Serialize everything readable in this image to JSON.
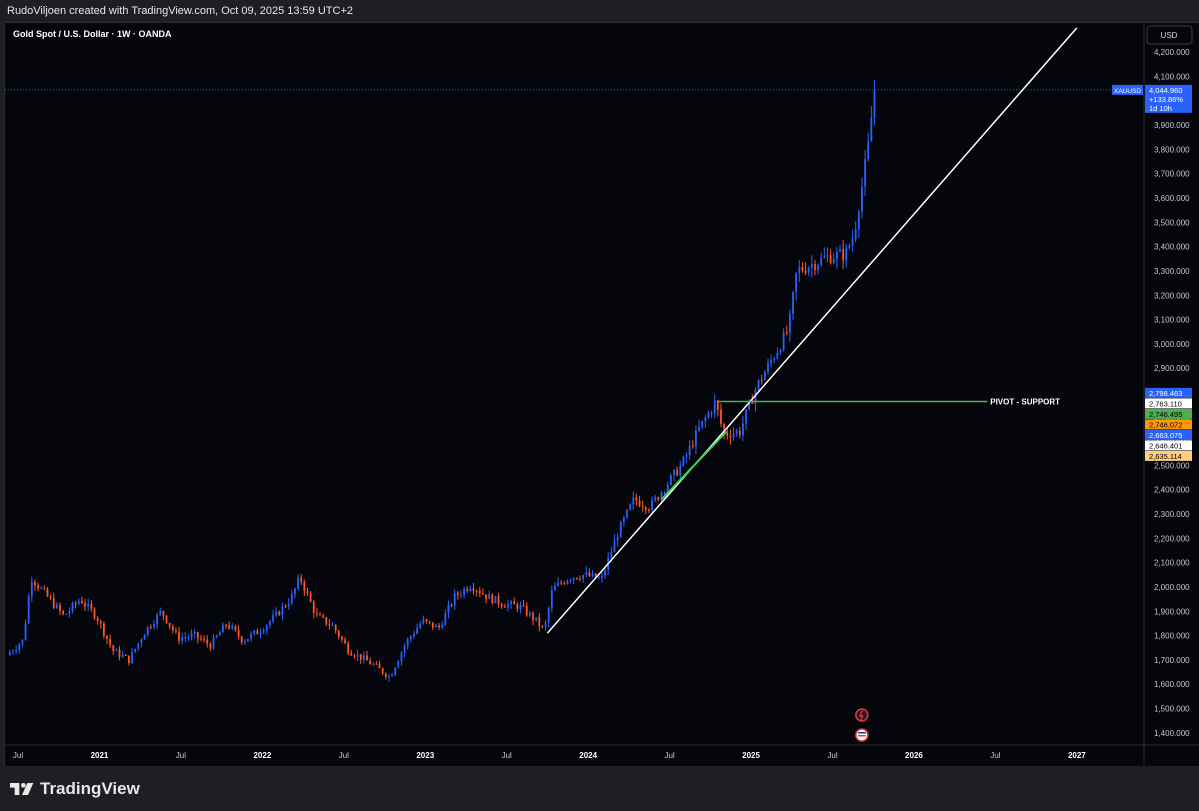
{
  "header": {
    "attribution": "RudoViljoen created with TradingView.com, Oct 09, 2025 13:59 UTC+2"
  },
  "footer": {
    "brand": "TradingView"
  },
  "chart_data": {
    "type": "candlestick",
    "title": "Gold Spot / U.S. Dollar · 1W · OANDA",
    "currency": "USD",
    "symbol": "XAUUSD",
    "last_price": "4,044.960",
    "change": "+133.86%",
    "countdown": "1d 10h",
    "ylim": [
      1350,
      4320
    ],
    "y_ticks": [
      "1,400.000",
      "1,500.000",
      "1,600.000",
      "1,700.000",
      "1,800.000",
      "1,900.000",
      "2,000.000",
      "2,100.000",
      "2,200.000",
      "2,300.000",
      "2,400.000",
      "2,500.000",
      "2,600.000",
      "2,700.000",
      "2,800.000",
      "2,900.000",
      "3,000.000",
      "3,100.000",
      "3,200.000",
      "3,300.000",
      "3,400.000",
      "3,500.000",
      "3,600.000",
      "3,700.000",
      "3,800.000",
      "3,900.000",
      "4,000.000",
      "4,100.000",
      "4,200.000"
    ],
    "x_ticks": [
      {
        "label": "Jul",
        "major": false
      },
      {
        "label": "2021",
        "major": true
      },
      {
        "label": "Jul",
        "major": false
      },
      {
        "label": "2022",
        "major": true
      },
      {
        "label": "Jul",
        "major": false
      },
      {
        "label": "2023",
        "major": true
      },
      {
        "label": "Jul",
        "major": false
      },
      {
        "label": "2024",
        "major": true
      },
      {
        "label": "Jul",
        "major": false
      },
      {
        "label": "2025",
        "major": true
      },
      {
        "label": "Jul",
        "major": false
      },
      {
        "label": "2026",
        "major": true
      },
      {
        "label": "Jul",
        "major": false
      },
      {
        "label": "2027",
        "major": true
      }
    ],
    "price_path": [
      [
        2020.45,
        1720
      ],
      [
        2020.55,
        1780
      ],
      [
        2020.6,
        2040
      ],
      [
        2020.7,
        1960
      ],
      [
        2020.8,
        1880
      ],
      [
        2020.9,
        1950
      ],
      [
        2021.0,
        1880
      ],
      [
        2021.1,
        1740
      ],
      [
        2021.2,
        1700
      ],
      [
        2021.3,
        1820
      ],
      [
        2021.4,
        1900
      ],
      [
        2021.5,
        1790
      ],
      [
        2021.6,
        1800
      ],
      [
        2021.7,
        1760
      ],
      [
        2021.8,
        1850
      ],
      [
        2021.9,
        1780
      ],
      [
        2022.0,
        1820
      ],
      [
        2022.1,
        1880
      ],
      [
        2022.2,
        1960
      ],
      [
        2022.25,
        2040
      ],
      [
        2022.35,
        1880
      ],
      [
        2022.45,
        1840
      ],
      [
        2022.55,
        1740
      ],
      [
        2022.7,
        1680
      ],
      [
        2022.8,
        1630
      ],
      [
        2022.9,
        1770
      ],
      [
        2023.0,
        1860
      ],
      [
        2023.1,
        1830
      ],
      [
        2023.2,
        1960
      ],
      [
        2023.3,
        2010
      ],
      [
        2023.4,
        1960
      ],
      [
        2023.5,
        1930
      ],
      [
        2023.6,
        1920
      ],
      [
        2023.7,
        1860
      ],
      [
        2023.75,
        1820
      ],
      [
        2023.8,
        1990
      ],
      [
        2023.9,
        2040
      ],
      [
        2024.0,
        2050
      ],
      [
        2024.1,
        2030
      ],
      [
        2024.2,
        2220
      ],
      [
        2024.3,
        2360
      ],
      [
        2024.4,
        2330
      ],
      [
        2024.5,
        2420
      ],
      [
        2024.6,
        2510
      ],
      [
        2024.7,
        2650
      ],
      [
        2024.8,
        2760
      ],
      [
        2024.85,
        2630
      ],
      [
        2024.95,
        2640
      ],
      [
        2025.05,
        2820
      ],
      [
        2025.15,
        2940
      ],
      [
        2025.25,
        3060
      ],
      [
        2025.3,
        3300
      ],
      [
        2025.4,
        3330
      ],
      [
        2025.5,
        3360
      ],
      [
        2025.6,
        3370
      ],
      [
        2025.65,
        3450
      ],
      [
        2025.7,
        3650
      ],
      [
        2025.75,
        3860
      ],
      [
        2025.77,
        4044.96
      ]
    ],
    "annotations": [
      {
        "type": "trendline",
        "label": "",
        "color": "#ffffff",
        "from": [
          2023.75,
          1810
        ],
        "to": [
          2027.0,
          4300
        ]
      },
      {
        "type": "hline",
        "label": "PIVOT - SUPPORT",
        "color": "#4caf50",
        "from": [
          2024.8,
          2763.11
        ],
        "to": [
          2026.45,
          2763.11
        ]
      },
      {
        "type": "segment",
        "label": "",
        "color": "#39d353",
        "from": [
          2024.45,
          2360
        ],
        "to": [
          2024.85,
          2640
        ]
      }
    ],
    "price_tags": [
      {
        "value": 2798.463,
        "label": "2,798.463",
        "bg": "#2962ff",
        "fg": "#ffffff"
      },
      {
        "value": 2763.11,
        "label": "2,763.110",
        "bg": "#ffffff",
        "fg": "#000000"
      },
      {
        "value": 2746.495,
        "label": "2,746.495",
        "bg": "#4caf50",
        "fg": "#000000"
      },
      {
        "value": 2746.072,
        "label": "2,746.072",
        "bg": "#ff9800",
        "fg": "#000000"
      },
      {
        "value": 2663.075,
        "label": "2,663.075",
        "bg": "#2962ff",
        "fg": "#ffffff"
      },
      {
        "value": 2646.401,
        "label": "2,646.401",
        "bg": "#ffffff",
        "fg": "#000000"
      },
      {
        "value": 2635.114,
        "label": "2,635.114",
        "bg": "#ffcc80",
        "fg": "#000000"
      }
    ],
    "colors": {
      "up": "#2962ff",
      "down": "#ff5722",
      "background": "#05050c"
    }
  }
}
